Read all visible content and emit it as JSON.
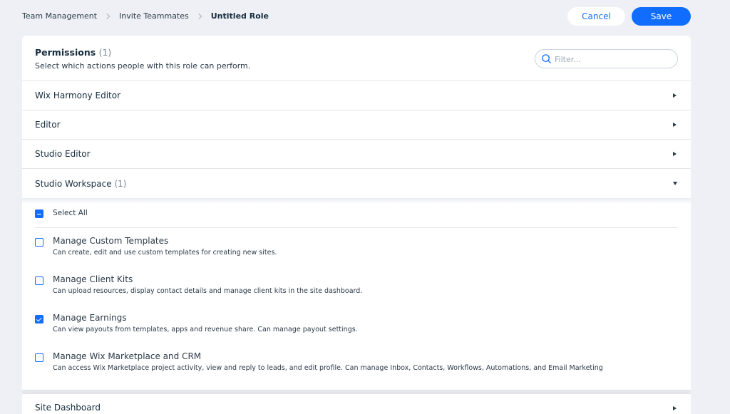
{
  "breadcrumb": {
    "items": [
      "Team Management",
      "Invite Teammates",
      "Untitled Role"
    ]
  },
  "actions": {
    "cancel_label": "Cancel",
    "save_label": "Save"
  },
  "colors": {
    "accent": "#116dff",
    "page_bg": "#eef0f5",
    "text": "#162d3d"
  },
  "permissions": {
    "title": "Permissions",
    "count": "(1)",
    "subtitle": "Select which actions people with this role can perform.",
    "filter_placeholder": "Filter..."
  },
  "sections": [
    {
      "label": "Wix Harmony Editor",
      "count": "",
      "expanded": false
    },
    {
      "label": "Editor",
      "count": "",
      "expanded": false
    },
    {
      "label": "Studio Editor",
      "count": "",
      "expanded": false
    },
    {
      "label": "Studio Workspace",
      "count": "(1)",
      "expanded": true
    },
    {
      "label": "Site Dashboard",
      "count": "",
      "expanded": false
    }
  ],
  "studio_workspace": {
    "select_all_label": "Select All",
    "select_all_state": "indeterminate",
    "items": [
      {
        "title": "Manage Custom Templates",
        "description": "Can create, edit and use custom templates for creating new sites.",
        "checked": false
      },
      {
        "title": "Manage Client Kits",
        "description": "Can upload resources, display contact details and manage client kits in the site dashboard.",
        "checked": false
      },
      {
        "title": "Manage Earnings",
        "description": "Can view payouts from templates, apps and revenue share. Can manage payout settings.",
        "checked": true
      },
      {
        "title": "Manage Wix Marketplace and CRM",
        "description": "Can access Wix Marketplace project activity, view and reply to leads, and edit profile. Can manage Inbox, Contacts, Workflows, Automations, and Email Marketing",
        "checked": false
      }
    ]
  }
}
